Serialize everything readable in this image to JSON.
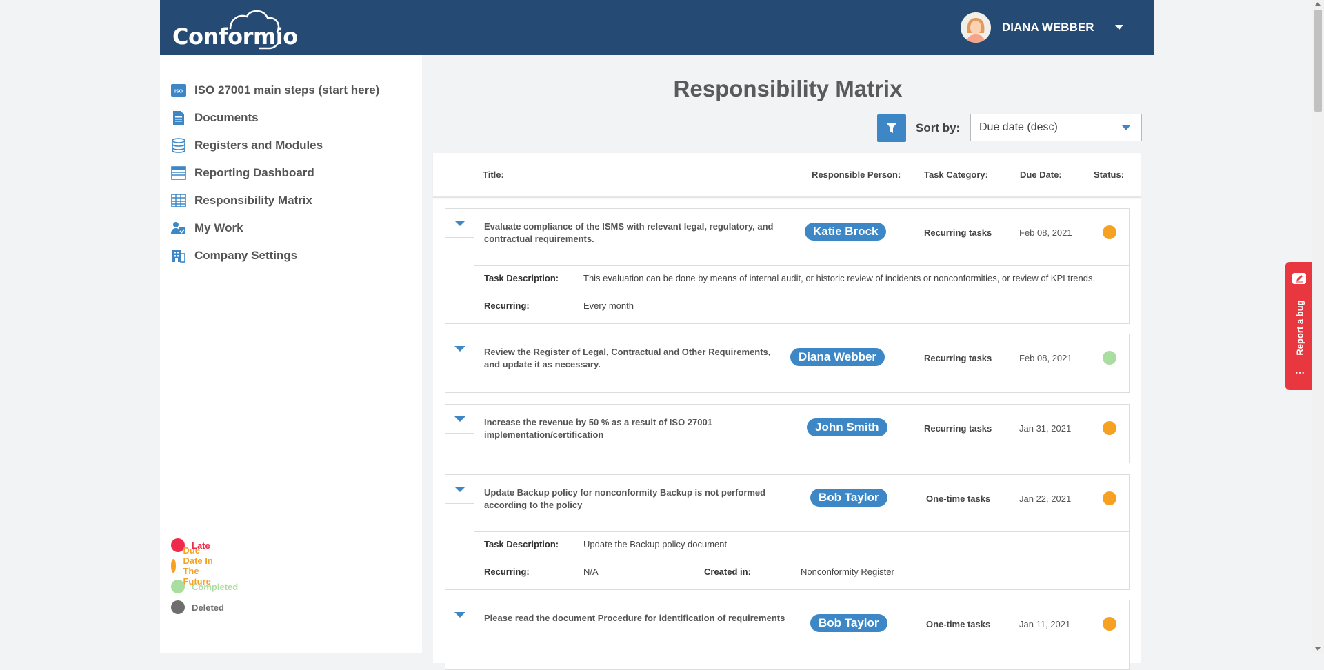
{
  "app": {
    "logo_text": "Conformio"
  },
  "user": {
    "name": "DIANA WEBBER"
  },
  "sidebar": {
    "items": [
      {
        "label": "ISO 27001 main steps (start here)",
        "icon": "iso-icon"
      },
      {
        "label": "Documents",
        "icon": "document-icon"
      },
      {
        "label": "Registers and Modules",
        "icon": "database-icon"
      },
      {
        "label": "Reporting Dashboard",
        "icon": "dashboard-icon"
      },
      {
        "label": "Responsibility Matrix",
        "icon": "matrix-icon"
      },
      {
        "label": "My Work",
        "icon": "user-check-icon"
      },
      {
        "label": "Company Settings",
        "icon": "building-icon"
      }
    ],
    "legend": [
      {
        "label": "Late",
        "color": "#ef2a4a"
      },
      {
        "label": "Due Date In The Future",
        "color": "#f7a123"
      },
      {
        "label": "Completed",
        "color": "#a9dea0"
      },
      {
        "label": "Deleted",
        "color": "#6e6e6e"
      }
    ]
  },
  "main": {
    "title": "Responsibility Matrix",
    "sort_label": "Sort by:",
    "sort_value": "Due date (desc)",
    "columns": {
      "title": "Title:",
      "person": "Responsible Person:",
      "category": "Task Category:",
      "due": "Due Date:",
      "status": "Status:"
    },
    "tasks": [
      {
        "title": "Evaluate compliance of the ISMS with relevant legal, regulatory, and contractual requirements.",
        "person": "Katie Brock",
        "category": "Recurring tasks",
        "due": "Feb 08, 2021",
        "status_color": "#f7a123",
        "details": {
          "desc_label": "Task Description:",
          "desc": "This evaluation can be done by means of internal audit, or historic review of incidents or nonconformities, or review of KPI trends.",
          "recurring_label": "Recurring:",
          "recurring": "Every month"
        }
      },
      {
        "title": "Review the Register of Legal, Contractual and Other Requirements, and update it as necessary.",
        "person": "Diana Webber",
        "category": "Recurring tasks",
        "due": "Feb 08, 2021",
        "status_color": "#a9dea0"
      },
      {
        "title": "Increase the revenue by 50 % as a result of ISO 27001 implementation/certification",
        "person": "John Smith",
        "category": "Recurring tasks",
        "due": "Jan 31, 2021",
        "status_color": "#f7a123"
      },
      {
        "title": "Update Backup policy for nonconformity Backup is not performed according to the policy",
        "person": "Bob Taylor",
        "category": "One-time tasks",
        "due": "Jan 22, 2021",
        "status_color": "#f7a123",
        "details": {
          "desc_label": "Task Description:",
          "desc": "Update the Backup policy document",
          "recurring_label": "Recurring:",
          "recurring": "N/A",
          "created_label": "Created in:",
          "created": "Nonconformity Register"
        }
      },
      {
        "title": "Please read the document Procedure for identification of requirements",
        "person": "Bob Taylor",
        "category": "One-time tasks",
        "due": "Jan 11, 2021",
        "status_color": "#f7a123"
      }
    ]
  },
  "report_bug": {
    "label": "Report a bug"
  }
}
